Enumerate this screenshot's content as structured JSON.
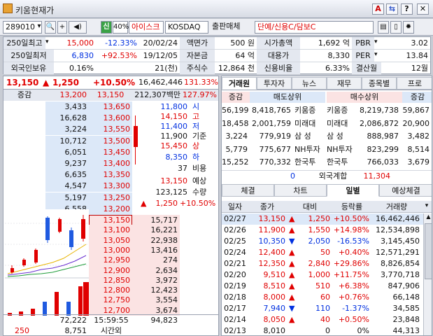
{
  "window": {
    "title": "키움현재가",
    "buttons": [
      "A",
      "⇆",
      "?",
      "✕"
    ]
  },
  "toolbar": {
    "code": "289010",
    "market_tag": "신",
    "margin": "40%",
    "name": "아이스크림에",
    "market": "KOSDAQ",
    "category": "출판매체",
    "flags": "단예/신용C/담보C"
  },
  "info": {
    "r1": {
      "l1": "250일최고",
      "v1": "15,000",
      "p1": "-12.33%",
      "d1": "20/02/24",
      "l2": "액면가",
      "v2": "500 원",
      "l3": "시가총액",
      "v3": "1,692 억",
      "l4": "PBR",
      "v4": "3.02"
    },
    "r2": {
      "l1": "250일최저",
      "v1": "6,830",
      "p1": "+92.53%",
      "d1": "19/12/05",
      "l2": "자본금",
      "v2": "64 억",
      "l3": "대용가",
      "v3": "8,330",
      "l4": "PER",
      "v4": "13.84"
    },
    "r3": {
      "l1": "외국인보유",
      "v1": "0.16%",
      "d1": "21(천)",
      "l2": "주식수",
      "v2": "12,864 천",
      "l3": "신용비율",
      "v3": "6.33%",
      "l4": "결산월",
      "v4": "12월"
    }
  },
  "quote": {
    "price": "13,150",
    "change": "1,250",
    "rate": "+10.50%",
    "volume": "16,462,446",
    "vol_rate": "131.33%",
    "hdr_change": "증감",
    "hdr_base": "13,200",
    "hdr_price": "13,150",
    "amount": "212,307백만",
    "turnover": "127.97%"
  },
  "asks": [
    {
      "qty": "3,433",
      "price": "13,650"
    },
    {
      "qty": "16,628",
      "price": "13,600"
    },
    {
      "qty": "3,224",
      "price": "13,550"
    },
    {
      "qty": "10,712",
      "price": "13,500"
    },
    {
      "qty": "6,051",
      "price": "13,450"
    },
    {
      "qty": "9,237",
      "price": "13,400"
    },
    {
      "qty": "6,635",
      "price": "13,350"
    },
    {
      "qty": "4,547",
      "price": "13,300"
    },
    {
      "qty": "5,197",
      "price": "13,250"
    },
    {
      "qty": "6,558",
      "price": "13,200"
    }
  ],
  "bids": [
    {
      "price": "13,150",
      "qty": "15,717"
    },
    {
      "price": "13,100",
      "qty": "16,221"
    },
    {
      "price": "13,050",
      "qty": "22,938"
    },
    {
      "price": "13,000",
      "qty": "13,416"
    },
    {
      "price": "12,950",
      "qty": "274"
    },
    {
      "price": "12,900",
      "qty": "2,634"
    },
    {
      "price": "12,850",
      "qty": "3,972"
    },
    {
      "price": "12,800",
      "qty": "12,423"
    },
    {
      "price": "12,750",
      "qty": "3,554"
    },
    {
      "price": "12,700",
      "qty": "3,674"
    }
  ],
  "summary": [
    {
      "v": "11,800",
      "k": "시"
    },
    {
      "v": "14,150",
      "k": "고"
    },
    {
      "v": "11,400",
      "k": "저"
    },
    {
      "v": "11,900",
      "k": "기준"
    },
    {
      "v": "15,450",
      "k": "상"
    },
    {
      "v": "8,350",
      "k": "하"
    },
    {
      "v": "37",
      "k": "비용"
    }
  ],
  "expected": {
    "price": "13,150",
    "label": "예상",
    "volume": "123,125",
    "vlabel": "수량",
    "change": "1,250",
    "rate": "+10.50%"
  },
  "footer": {
    "ask_total": "72,222",
    "time": "15:59:55",
    "bid_total": "94,823",
    "n1": "250",
    "n2": "8,751",
    "time_label": "시간외"
  },
  "rtabs": [
    "거래원",
    "투자자",
    "뉴스",
    "재무",
    "종목별",
    "프로"
  ],
  "broker": {
    "hdr": [
      "증감",
      "매도상위",
      "매수상위",
      "증감"
    ],
    "rows": [
      {
        "d1": "56,199",
        "sq": "8,418,765",
        "sn": "키움증",
        "bn": "키움증",
        "bq": "8,219,738",
        "d2": "59,867"
      },
      {
        "d1": "18,458",
        "sq": "2,001,759",
        "sn": "미래대",
        "bn": "미래대",
        "bq": "2,086,872",
        "d2": "20,900"
      },
      {
        "d1": "3,224",
        "sq": "779,919",
        "sn": "삼 성",
        "bn": "삼 성",
        "bq": "888,987",
        "d2": "3,482"
      },
      {
        "d1": "5,779",
        "sq": "775,677",
        "sn": "NH투자",
        "bn": "NH투자",
        "bq": "823,299",
        "d2": "8,514"
      },
      {
        "d1": "15,252",
        "sq": "770,332",
        "sn": "한국투",
        "bn": "한국투",
        "bq": "766,033",
        "d2": "3,679"
      }
    ],
    "foreign": {
      "d1": "0",
      "label": "외국계합",
      "bq": "11,304"
    }
  },
  "btabs": [
    "체결",
    "차트",
    "일별",
    "예상체결"
  ],
  "daily": {
    "hdr": [
      "일자",
      "종가",
      "대비",
      "등락률",
      "거래량"
    ],
    "rows": [
      {
        "date": "02/27",
        "close": "13,150",
        "dir": "up",
        "chg": "1,250",
        "rate": "+10.50%",
        "vol": "16,462,446"
      },
      {
        "date": "02/26",
        "close": "11,900",
        "dir": "up",
        "chg": "1,550",
        "rate": "+14.98%",
        "vol": "12,534,898"
      },
      {
        "date": "02/25",
        "close": "10,350",
        "dir": "down",
        "chg": "2,050",
        "rate": "-16.53%",
        "vol": "3,145,450"
      },
      {
        "date": "02/24",
        "close": "12,400",
        "dir": "up",
        "chg": "50",
        "rate": "+0.40%",
        "vol": "12,571,291"
      },
      {
        "date": "02/21",
        "close": "12,350",
        "dir": "up",
        "chg": "2,840",
        "rate": "+29.86%",
        "vol": "8,826,854"
      },
      {
        "date": "02/20",
        "close": "9,510",
        "dir": "up",
        "chg": "1,000",
        "rate": "+11.75%",
        "vol": "3,770,718"
      },
      {
        "date": "02/19",
        "close": "8,510",
        "dir": "up",
        "chg": "510",
        "rate": "+6.38%",
        "vol": "847,906"
      },
      {
        "date": "02/18",
        "close": "8,000",
        "dir": "up",
        "chg": "60",
        "rate": "+0.76%",
        "vol": "66,148"
      },
      {
        "date": "02/17",
        "close": "7,940",
        "dir": "down",
        "chg": "110",
        "rate": "-1.37%",
        "vol": "34,585"
      },
      {
        "date": "02/14",
        "close": "8,050",
        "dir": "up",
        "chg": "40",
        "rate": "+0.50%",
        "vol": "23,848"
      },
      {
        "date": "02/13",
        "close": "8,010",
        "dir": "flat",
        "chg": "0",
        "rate": "0%",
        "vol": "44,313"
      }
    ]
  }
}
